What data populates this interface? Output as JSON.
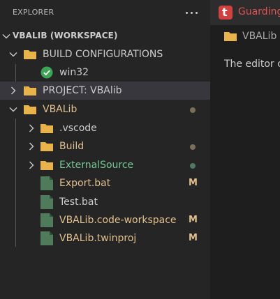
{
  "colors": {
    "sidebar_bg": "#252526",
    "editor_bg": "#1e1e1e",
    "selected_row": "#37373d",
    "folder": "#e8b34a",
    "modified": "#e2c08d",
    "untracked": "#73c991",
    "dot_modified": "#7c6f5a",
    "dot_untracked": "#4e7a63",
    "success": "#3aa655",
    "accent_red": "#e05252"
  },
  "sidebar": {
    "title": "EXPLORER",
    "more_actions_icon": "ellipsis-icon",
    "workspace_label": "VBALIB (WORKSPACE)",
    "tree": [
      {
        "label": "BUILD CONFIGURATIONS",
        "type": "folder",
        "expanded": true
      },
      {
        "label": "win32",
        "type": "config",
        "icon": "check-circle-icon"
      },
      {
        "label": "PROJECT: VBAlib",
        "type": "folder",
        "expanded": false,
        "selected": true
      },
      {
        "label": "VBALib",
        "type": "folder",
        "expanded": true,
        "decoration": "modified-dot"
      },
      {
        "label": ".vscode",
        "type": "folder",
        "expanded": false
      },
      {
        "label": "Build",
        "type": "folder",
        "expanded": false,
        "decoration": "modified-dot"
      },
      {
        "label": "ExternalSource",
        "type": "folder",
        "expanded": false,
        "decoration": "untracked-dot"
      },
      {
        "label": "Export.bat",
        "type": "file",
        "badge": "M"
      },
      {
        "label": "Test.bat",
        "type": "file"
      },
      {
        "label": "VBALib.code-workspace",
        "type": "file",
        "badge": "M"
      },
      {
        "label": "VBALib.twinproj",
        "type": "file",
        "badge": "M"
      }
    ]
  },
  "editor": {
    "tab_title": "Guarding",
    "tab_icon_letter": "t",
    "breadcrumb": "VBALib",
    "message": "The editor c"
  }
}
